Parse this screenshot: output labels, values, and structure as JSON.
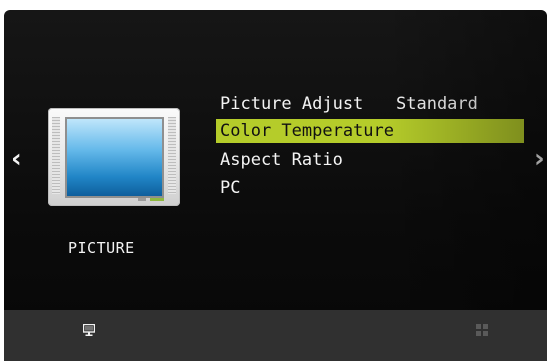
{
  "osd": {
    "category": "PICTURE",
    "category_icon": "tv-icon",
    "nav": {
      "left_glyph": "‹",
      "right_glyph": "›"
    },
    "menu": [
      {
        "label": "Picture Adjust",
        "value": "Standard",
        "selected": false
      },
      {
        "label": "Color Temperature",
        "value": "",
        "selected": true
      },
      {
        "label": "Aspect Ratio",
        "value": "",
        "selected": false
      },
      {
        "label": "PC",
        "value": "",
        "selected": false
      }
    ],
    "footer": {
      "left_icon": "monitor-icon",
      "right_icon": "grid-icon"
    }
  },
  "colors": {
    "panel": "#0b0b0b",
    "highlight": "#b5cc2a",
    "text": "#f4f4f4",
    "footer": "#303030"
  }
}
